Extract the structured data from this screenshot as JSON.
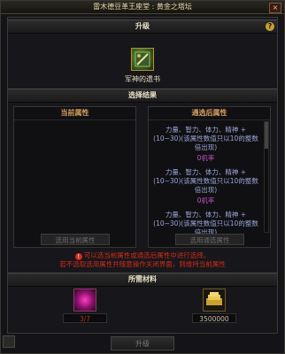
{
  "window": {
    "title": "雷木德豆革王座堂 : 黄金之塔坛",
    "close_label": "×"
  },
  "upgrade_section": {
    "title": "升级",
    "help_label": "?",
    "item_name": "军神的遗书"
  },
  "choose_section": {
    "title": "选择结果",
    "current": {
      "header": "当前属性",
      "button_label": "选用当前属性"
    },
    "after": {
      "header": "通选后属性",
      "lines": [
        {
          "text": "力量、智力、体力、精神 +(10~30)(该属性数值只以10的整数倍出现)",
          "tag": "0机率"
        },
        {
          "text": "力量、智力、体力、精神 +(10~30)(该属性数值只以10的整数倍出现)",
          "tag": "0机率"
        },
        {
          "text": "力量、智力、体力、精神 +(10~30)(该属性数值只以10的整数倍出现)",
          "tag": ""
        }
      ],
      "button_label": "选用通选属性"
    },
    "warning_line1": "可以选当前属性或通选后属性中进行选择。",
    "warning_line2": "若不选取选用属性并随意操作关闭界面，则维持当前属性"
  },
  "materials": {
    "title": "所需材料",
    "items": [
      {
        "icon": "pink-orb-icon",
        "count": "3/7"
      },
      {
        "icon": "gold-coin-icon",
        "count": "3500000"
      }
    ]
  },
  "footer": {
    "upgrade_button": "升级"
  },
  "colors": {
    "accent_gold": "#c8a030",
    "warning_red": "#d02a1a",
    "attr_blue": "#9aa6d6",
    "tag_purple": "#c050c0"
  }
}
